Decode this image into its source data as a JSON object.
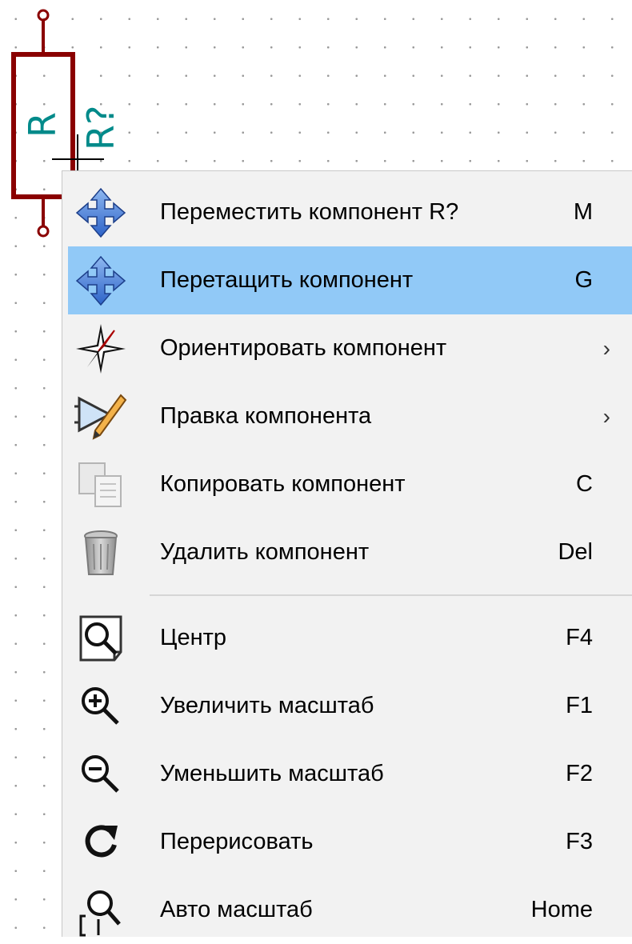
{
  "schematic": {
    "reference": "R?",
    "value": "R",
    "colors": {
      "body": "#8a0000",
      "text": "#008a8a",
      "cursor": "#000000"
    }
  },
  "context_menu": {
    "items": [
      {
        "label": "Переместить компонент R?",
        "shortcut": "M",
        "icon": "move-icon",
        "highlighted": false
      },
      {
        "label": "Перетащить компонент",
        "shortcut": "G",
        "icon": "drag-icon",
        "highlighted": true
      },
      {
        "label": "Ориентировать компонент",
        "shortcut": "",
        "icon": "orient-icon",
        "submenu": true
      },
      {
        "label": "Правка компонента",
        "shortcut": "",
        "icon": "edit-component-icon",
        "submenu": true
      },
      {
        "label": "Копировать компонент",
        "shortcut": "C",
        "icon": "copy-icon"
      },
      {
        "label": "Удалить компонент",
        "shortcut": "Del",
        "icon": "delete-icon"
      },
      {
        "label": "Центр",
        "shortcut": "F4",
        "icon": "zoom-center-icon"
      },
      {
        "label": "Увеличить масштаб",
        "shortcut": "F1",
        "icon": "zoom-in-icon"
      },
      {
        "label": "Уменьшить масштаб",
        "shortcut": "F2",
        "icon": "zoom-out-icon"
      },
      {
        "label": "Перерисовать",
        "shortcut": "F3",
        "icon": "redraw-icon"
      },
      {
        "label": "Авто масштаб",
        "shortcut": "Home",
        "icon": "zoom-auto-icon"
      }
    ],
    "submenu_arrow": "›",
    "colors": {
      "background": "#f2f2f2",
      "highlight": "#91c9f7"
    }
  }
}
